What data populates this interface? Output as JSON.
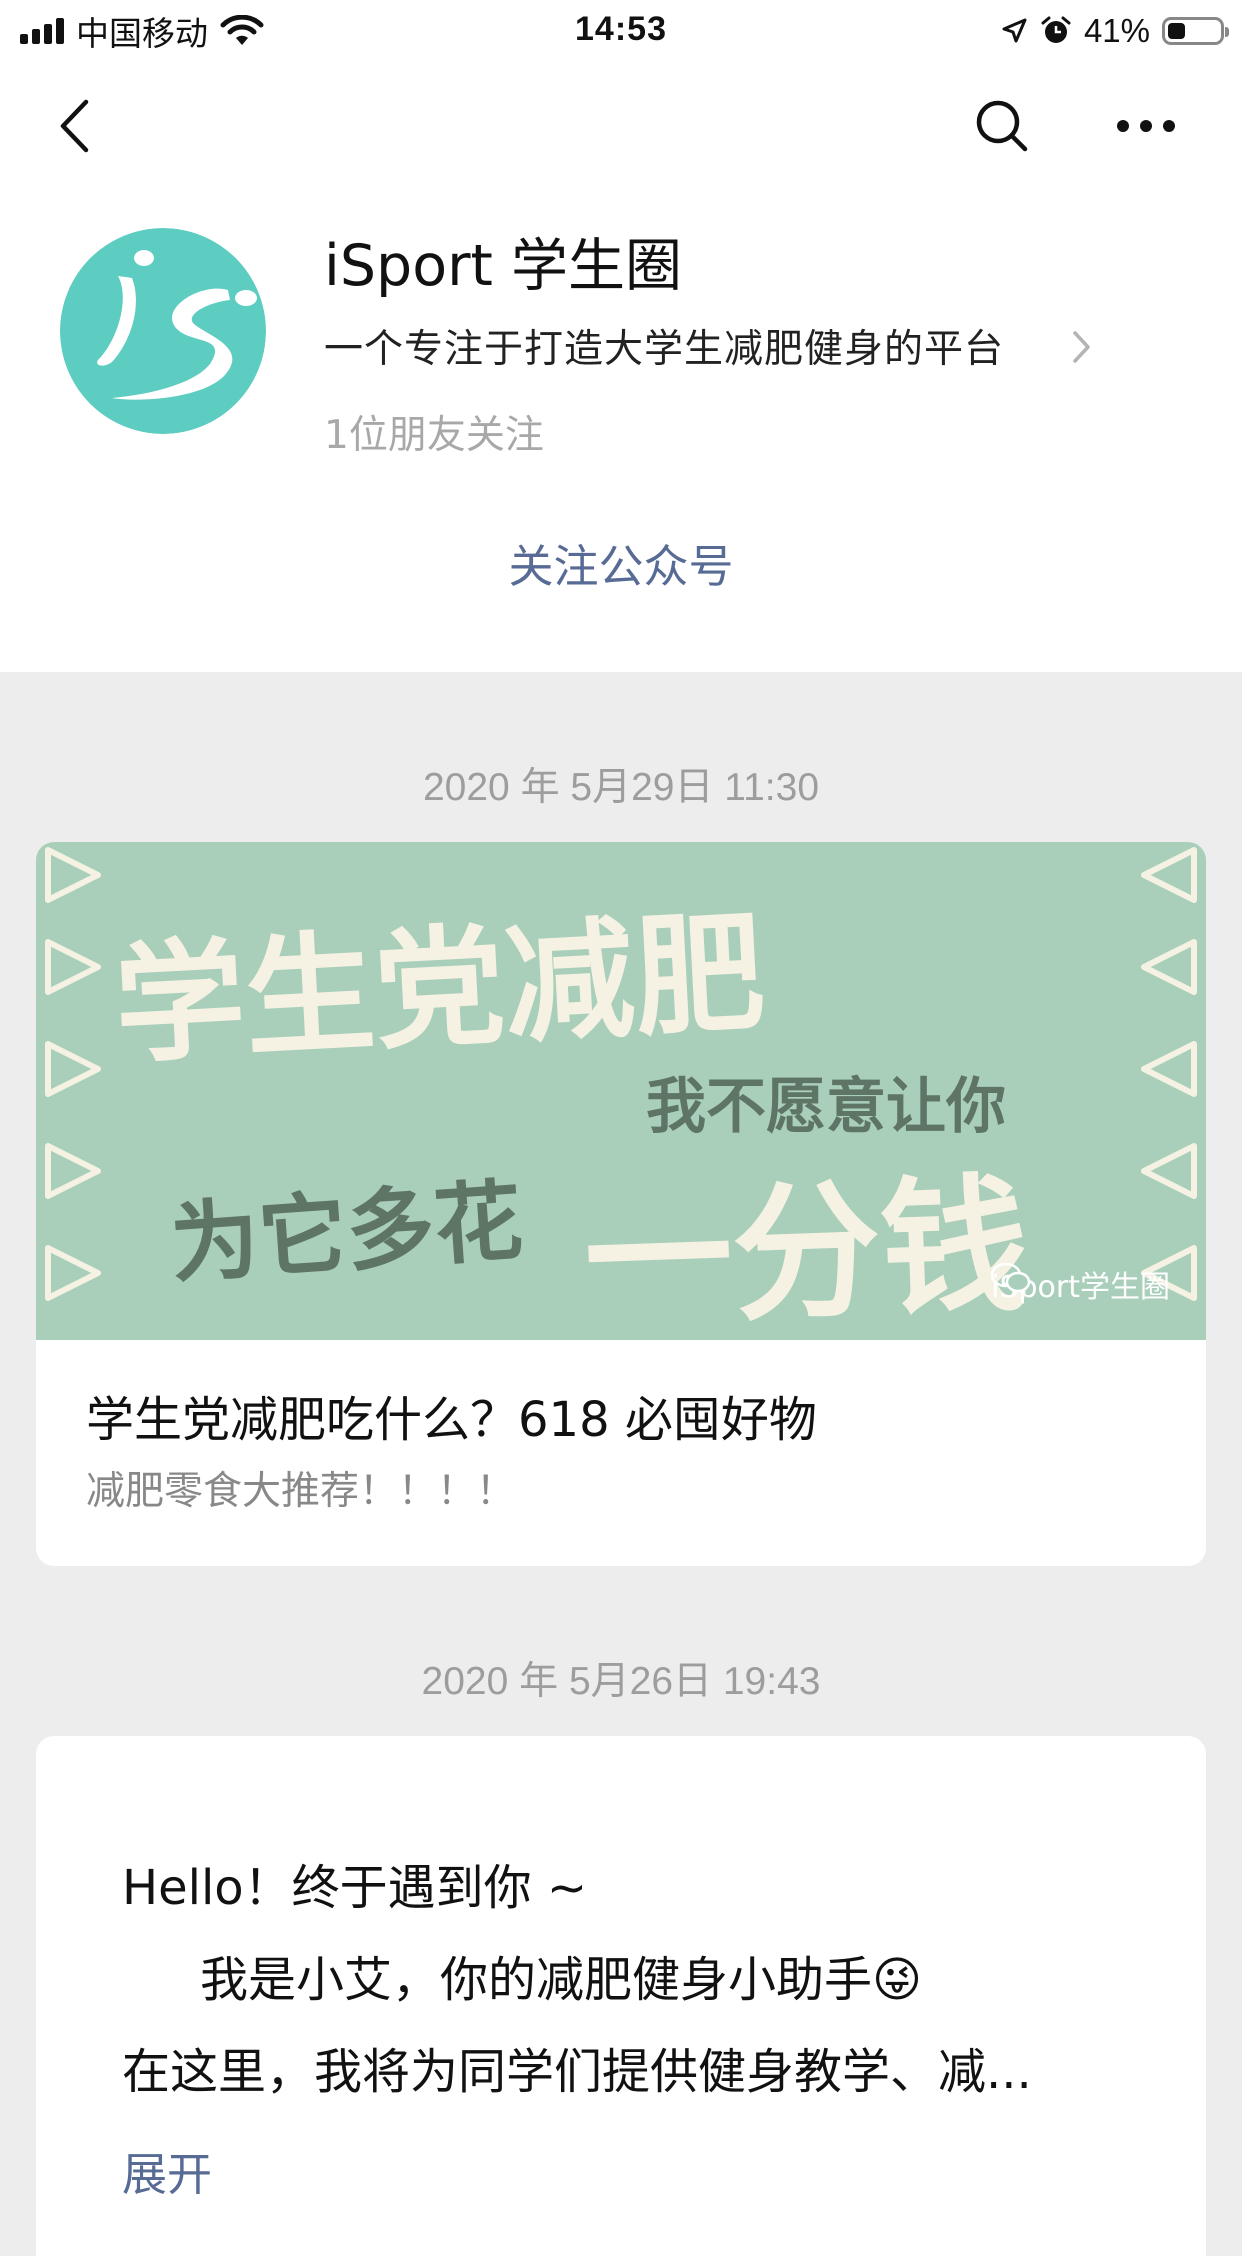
{
  "status_bar": {
    "carrier": "中国移动",
    "time": "14:53",
    "battery_percent": "41%",
    "battery_level": 0.41,
    "icons": [
      "signal-icon",
      "wifi-icon",
      "location-icon",
      "alarm-icon",
      "battery-icon"
    ]
  },
  "nav": {
    "icons": [
      "back-icon",
      "search-icon",
      "more-icon"
    ]
  },
  "account": {
    "name": "iSport 学生圈",
    "description": "一个专注于打造大学生减肥健身的平台",
    "followers": "1位朋友关注",
    "follow_button": "关注公众号"
  },
  "feed": [
    {
      "date": "2020 年 5月29日 11:30",
      "cover_texts": {
        "line1": "学生党减肥",
        "line2": "我不愿意让你",
        "line3a": "为它多花",
        "line3b": "一分钱",
        "watermark": "iSport学生圈"
      },
      "title": "学生党减肥吃什么？618 必囤好物",
      "subtitle": "减肥零食大推荐！！！！"
    },
    {
      "date": "2020 年 5月26日 19:43",
      "lines": [
        "Hello！终于遇到你 ~",
        "我是小艾，你的减肥健身小助手😜",
        "在这里，我将为同学们提供健身教学、减..."
      ],
      "expand_label": "展开"
    }
  ],
  "colors": {
    "link": "#576b95",
    "avatar": "#5ecdc1",
    "cover_bg": "#a9cfbb",
    "cover_light": "#f5f2e4",
    "cover_dark": "#5e7465",
    "page_bg": "#ededed"
  }
}
